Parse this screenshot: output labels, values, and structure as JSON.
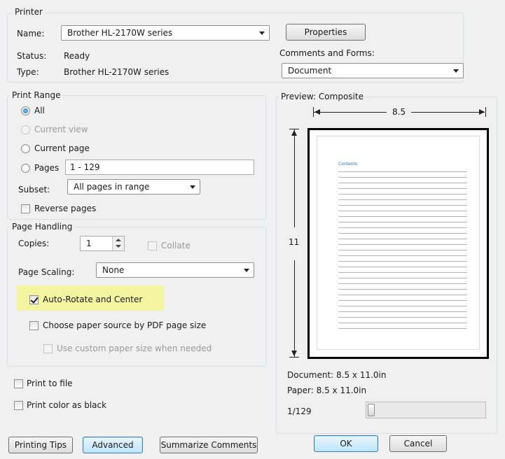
{
  "printer": {
    "group_title": "Printer",
    "name_label": "Name:",
    "name_value": "Brother HL-2170W series",
    "status_label": "Status:",
    "status_value": "Ready",
    "type_label": "Type:",
    "type_value": "Brother HL-2170W series",
    "properties_button": "Properties",
    "comments_label": "Comments and Forms:",
    "comments_value": "Document"
  },
  "print_range": {
    "group_title": "Print Range",
    "all": "All",
    "current_view": "Current view",
    "current_page": "Current page",
    "pages_label": "Pages",
    "pages_value": "1 - 129",
    "subset_label": "Subset:",
    "subset_value": "All pages in range",
    "reverse_pages": "Reverse pages"
  },
  "page_handling": {
    "group_title": "Page Handling",
    "copies_label": "Copies:",
    "copies_value": "1",
    "collate": "Collate",
    "scaling_label": "Page Scaling:",
    "scaling_value": "None",
    "auto_rotate": "Auto-Rotate and Center",
    "choose_paper": "Choose paper source by PDF page size",
    "custom_paper": "Use custom paper size when needed"
  },
  "options": {
    "print_to_file": "Print to file",
    "print_color_black": "Print color as black"
  },
  "preview": {
    "title": "Preview: Composite",
    "width_label": "8.5",
    "height_label": "11",
    "page_heading": "Contents",
    "document_size": "Document: 8.5 x 11.0in",
    "paper_size": "Paper: 8.5 x 11.0in",
    "page_counter": "1/129",
    "slider_fraction": 0.0
  },
  "buttons": {
    "printing_tips": "Printing Tips",
    "advanced": "Advanced",
    "summarize": "Summarize Comments",
    "ok": "OK",
    "cancel": "Cancel"
  },
  "colors": {
    "highlight": "#f3f4a0",
    "accent": "#1b5fa8"
  }
}
